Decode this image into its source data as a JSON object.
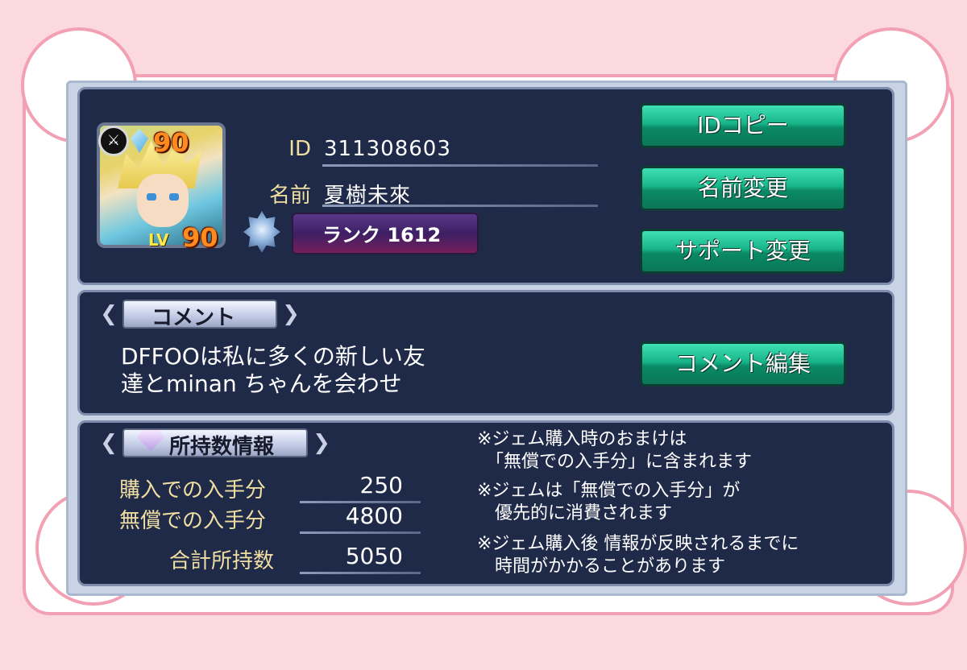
{
  "profile": {
    "id_label": "ID",
    "id_value": "311308603",
    "name_label": "名前",
    "name_value": "夏樹未來",
    "rank_text": "ランク 1612",
    "level_top": "90",
    "lv_label": "LV",
    "level_value": "90"
  },
  "buttons": {
    "id_copy": "IDコピー",
    "name_change": "名前変更",
    "support_change": "サポート変更",
    "comment_edit": "コメント編集"
  },
  "comment": {
    "header": "コメント",
    "text": "DFFOOは私に多くの新しい友\n達とminan  ちゃんを会わせ"
  },
  "holdings": {
    "header": "所持数情報",
    "rows": [
      {
        "label": "購入での入手分",
        "value": "250"
      },
      {
        "label": "無償での入手分",
        "value": "4800"
      },
      {
        "label": "合計所持数",
        "value": "5050"
      }
    ],
    "notes": [
      "※ジェム購入時のおまけは\n　「無償での入手分」に含まれます",
      "※ジェムは「無償での入手分」が\n　優先的に消費されます",
      "※ジェム購入後 情報が反映されるまでに\n　時間がかかることがあります"
    ]
  },
  "colors": {
    "background_pink": "#fcd9df",
    "frame_border": "#f2a0b4",
    "panel_navy": "#1f2a49",
    "label_gold": "#f1dfa2",
    "button_green": "#18b489",
    "level_orange": "#ff8a1f"
  }
}
